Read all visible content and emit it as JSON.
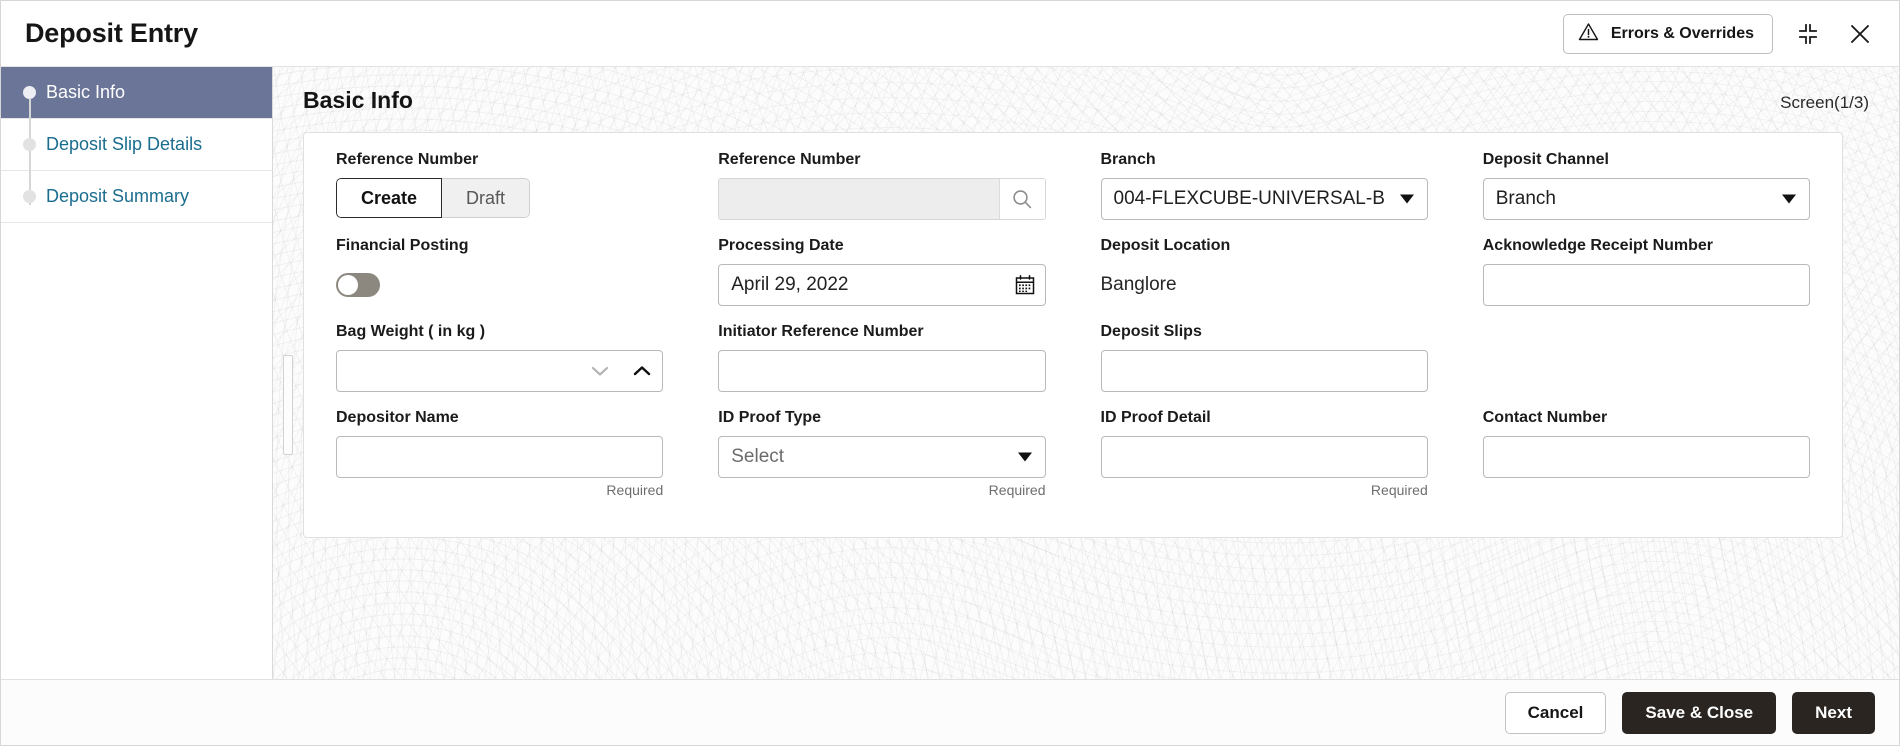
{
  "window": {
    "title": "Deposit Entry",
    "errors_button": "Errors & Overrides",
    "minimize_icon": "collapse-icon",
    "close_icon": "close-icon"
  },
  "sidebar": {
    "items": [
      {
        "label": "Basic Info",
        "active": true
      },
      {
        "label": "Deposit Slip Details",
        "active": false
      },
      {
        "label": "Deposit Summary",
        "active": false
      }
    ]
  },
  "main": {
    "section_title": "Basic Info",
    "screen_counter": "Screen(1/3)"
  },
  "form": {
    "reference_number_mode": {
      "label": "Reference Number",
      "options": [
        "Create",
        "Draft"
      ],
      "selected": "Create"
    },
    "reference_number": {
      "label": "Reference Number",
      "value": "",
      "placeholder": "",
      "disabled": true,
      "icon": "search-icon"
    },
    "branch": {
      "label": "Branch",
      "value": "004-FLEXCUBE-UNIVERSAL-B",
      "icon": "chevron-down-icon"
    },
    "deposit_channel": {
      "label": "Deposit Channel",
      "value": "Branch",
      "icon": "chevron-down-icon"
    },
    "financial_posting": {
      "label": "Financial Posting",
      "state": "off"
    },
    "processing_date": {
      "label": "Processing Date",
      "value": "April 29, 2022",
      "icon": "calendar-icon"
    },
    "deposit_location": {
      "label": "Deposit Location",
      "value": "Banglore"
    },
    "acknowledge_receipt_number": {
      "label": "Acknowledge Receipt Number",
      "value": "",
      "placeholder": ""
    },
    "bag_weight": {
      "label": "Bag Weight ( in kg )",
      "value": "",
      "placeholder": "",
      "down_icon": "chevron-down-icon",
      "up_icon": "chevron-up-icon"
    },
    "initiator_reference_number": {
      "label": "Initiator Reference Number",
      "value": "",
      "placeholder": ""
    },
    "deposit_slips": {
      "label": "Deposit Slips",
      "value": "",
      "placeholder": ""
    },
    "depositor_name": {
      "label": "Depositor Name",
      "value": "",
      "placeholder": "",
      "helper": "Required"
    },
    "id_proof_type": {
      "label": "ID Proof Type",
      "value": "Select",
      "is_placeholder": true,
      "helper": "Required",
      "icon": "chevron-down-icon"
    },
    "id_proof_detail": {
      "label": "ID Proof Detail",
      "value": "",
      "placeholder": "",
      "helper": "Required"
    },
    "contact_number": {
      "label": "Contact Number",
      "value": "",
      "placeholder": ""
    }
  },
  "footer": {
    "cancel": "Cancel",
    "save_close": "Save & Close",
    "next": "Next"
  },
  "colors": {
    "sidebar_active": "#6b7598",
    "sidebar_link": "#1b6d8f",
    "button_dark": "#2a2521",
    "toggle_off": "#8c8880"
  }
}
